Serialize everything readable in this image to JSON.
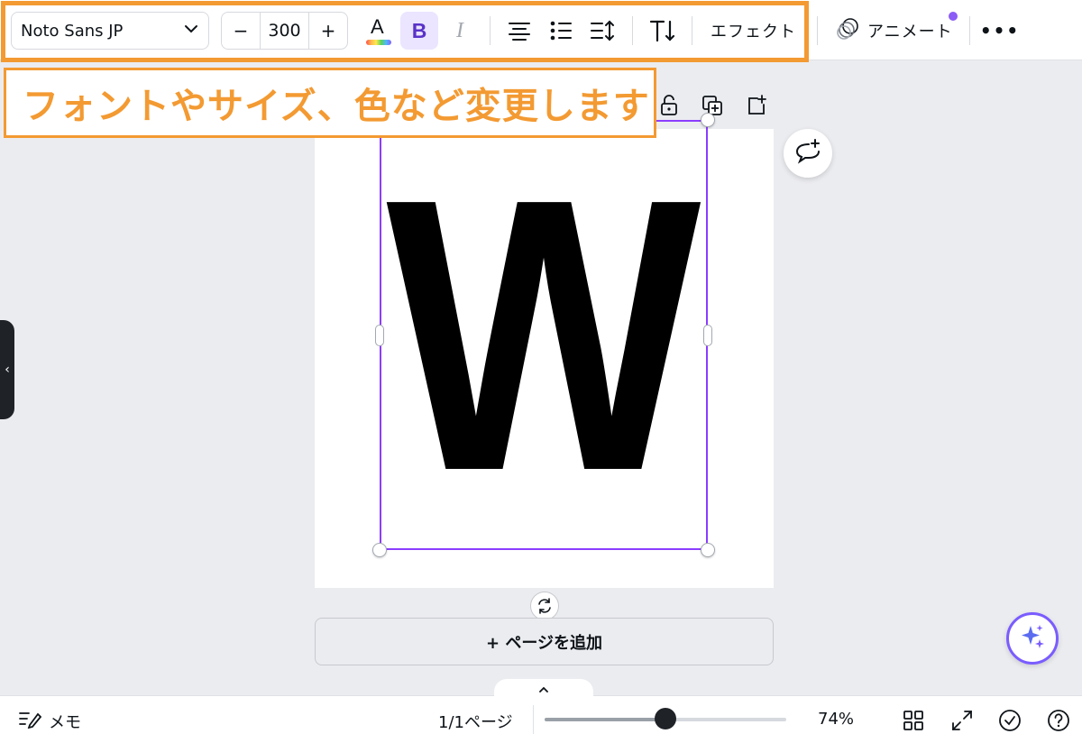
{
  "toolbar": {
    "font_name": "Noto Sans JP",
    "font_size": "300",
    "minus": "−",
    "plus": "+",
    "effect_label": "エフェクト",
    "animate_label": "アニメート",
    "more": "•••",
    "text_color_letter": "A",
    "bold_letter": "B",
    "italic_letter": "I",
    "accent_color": "#8b3dff",
    "highlight_color": "#f39a32"
  },
  "callout": {
    "text": "フォントやサイズ、色など変更します"
  },
  "canvas": {
    "glyph": "W",
    "add_page_label": "+ ページを追加",
    "selection_color": "#8b3dff"
  },
  "side_panel": {
    "toggle": "‹"
  },
  "bottom_bar": {
    "memo_label": "メモ",
    "page_indicator": "1/1ページ",
    "zoom_percent": "74%",
    "zoom_fraction": 0.5,
    "collapse_glyph": "⌃"
  }
}
